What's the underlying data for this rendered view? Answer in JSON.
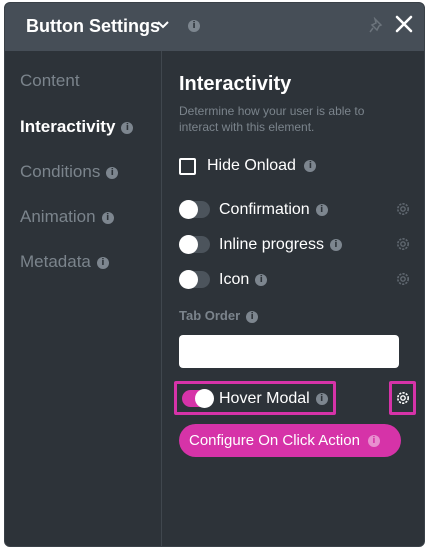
{
  "header": {
    "title": "Button Settings",
    "info_icon": "i"
  },
  "sidebar": {
    "items": [
      {
        "label": "Content",
        "active": false,
        "info": ""
      },
      {
        "label": "Interactivity",
        "active": true,
        "info": "i"
      },
      {
        "label": "Conditions",
        "active": false,
        "info": "i"
      },
      {
        "label": "Animation",
        "active": false,
        "info": "i"
      },
      {
        "label": "Metadata",
        "active": false,
        "info": "i"
      }
    ]
  },
  "main": {
    "section_title": "Interactivity",
    "section_desc": "Determine how your user is able to interact with this element.",
    "hide_onload": {
      "label": "Hide Onload",
      "checked": false,
      "info": "i"
    },
    "toggles": [
      {
        "label": "Confirmation",
        "on": false,
        "info": "i"
      },
      {
        "label": "Inline progress",
        "on": false,
        "info": "i"
      },
      {
        "label": "Icon",
        "on": false,
        "info": "i"
      }
    ],
    "tab_order": {
      "label": "Tab Order",
      "value": "",
      "info": "i"
    },
    "hover_modal": {
      "label": "Hover Modal",
      "on": true,
      "info": "i"
    },
    "cta": {
      "label": "Configure On Click Action",
      "info": "i"
    }
  },
  "colors": {
    "accent": "#d633a8",
    "panel_bg": "#2d3339",
    "header_bg": "#464e57",
    "muted_text": "#7b848c"
  },
  "icons": {
    "dropdown": "chevron-down-icon",
    "pin": "pin-icon",
    "close": "close-icon",
    "settings": "gear-icon",
    "info": "info-icon"
  }
}
